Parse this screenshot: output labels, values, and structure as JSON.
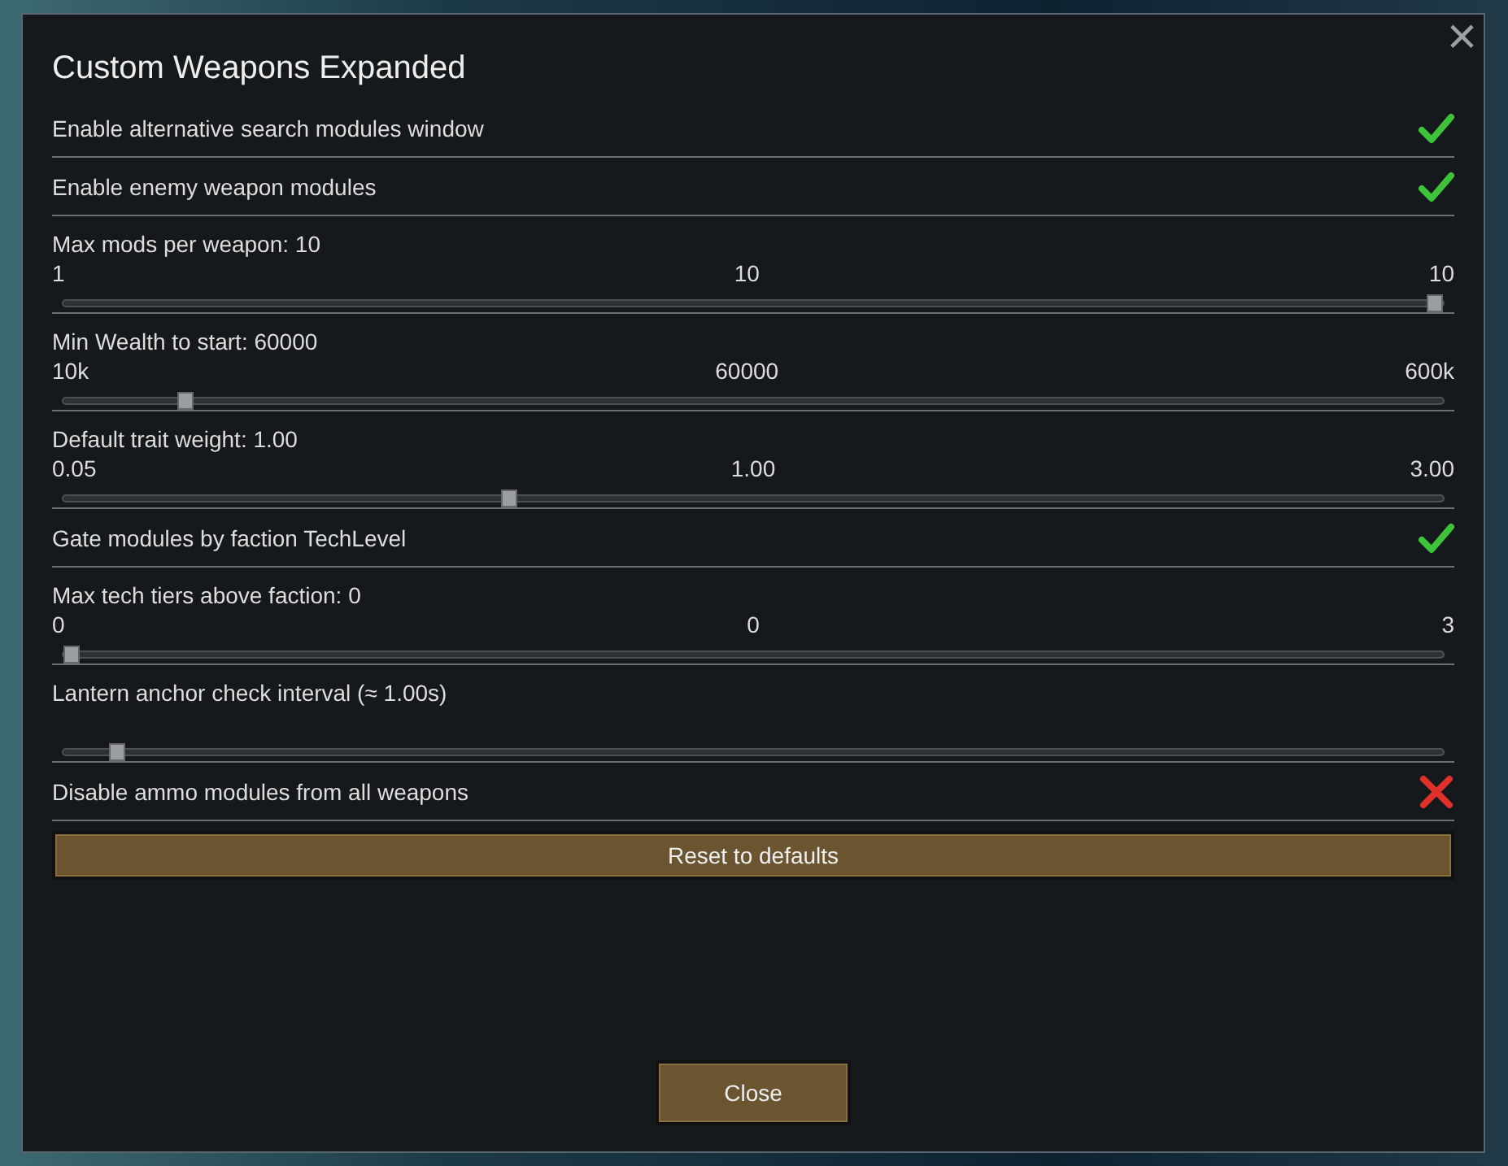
{
  "dialog": {
    "title": "Custom Weapons Expanded",
    "close_icon": "×",
    "settings": [
      {
        "kind": "toggle",
        "label": "Enable alternative search modules window",
        "checked": true
      },
      {
        "kind": "toggle",
        "label": "Enable enemy weapon modules",
        "checked": true
      },
      {
        "kind": "slider",
        "label": "Max mods per weapon: 10",
        "min": "1",
        "mid": "10",
        "max": "10",
        "level": 1.0
      },
      {
        "kind": "slider",
        "label": "Min Wealth to start: 60000",
        "min": "10k",
        "mid": "60000",
        "max": "600k",
        "level": 0.084
      },
      {
        "kind": "slider",
        "label": "Default trait weight: 1.00",
        "min": "0.05",
        "mid": "1.00",
        "max": "3.00",
        "level": 0.321
      },
      {
        "kind": "toggle",
        "label": "Gate modules by faction TechLevel",
        "checked": true
      },
      {
        "kind": "slider",
        "label": "Max tech tiers above faction: 0",
        "min": "0",
        "mid": "0",
        "max": "3",
        "level": 0.0
      },
      {
        "kind": "slider",
        "label": "Lantern anchor check interval (≈ 1.00s)",
        "level": 0.033
      },
      {
        "kind": "toggle",
        "label": "Disable ammo modules from all weapons",
        "checked": false
      }
    ],
    "reset_button": "Reset to defaults",
    "close_button": "Close"
  }
}
